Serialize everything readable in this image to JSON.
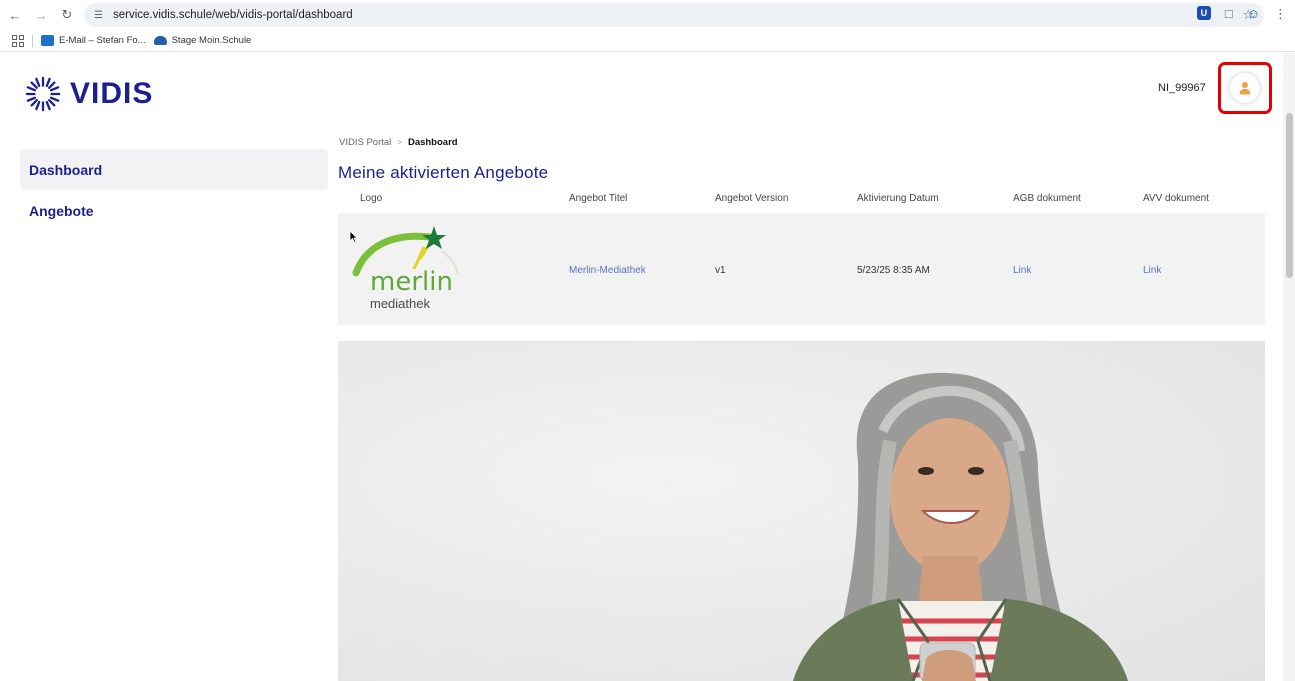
{
  "browser": {
    "url": "service.vidis.schule/web/vidis-portal/dashboard",
    "bookmarks": [
      {
        "label": "E-Mail – Stefan Fo..."
      },
      {
        "label": "Stage Moin.Schule"
      }
    ]
  },
  "header": {
    "brand": "VIDIS",
    "user_id": "NI_99967"
  },
  "sidebar": {
    "items": [
      {
        "label": "Dashboard",
        "active": true
      },
      {
        "label": "Angebote",
        "active": false
      }
    ]
  },
  "breadcrumb": {
    "root": "VIDIS Portal",
    "separator": ">",
    "current": "Dashboard"
  },
  "main": {
    "title": "Meine aktivierten Angebote",
    "table": {
      "columns": [
        "Logo",
        "Angebot Titel",
        "Angebot Version",
        "Aktivierung Datum",
        "AGB dokument",
        "AVV dokument"
      ],
      "rows": [
        {
          "logo_text": "merlin",
          "logo_subtext": "mediathek",
          "title": "Merlin-Mediathek",
          "version": "v1",
          "date": "5/23/25 8:35 AM",
          "agb": "Link",
          "avv": "Link"
        }
      ]
    }
  },
  "colors": {
    "brand": "#1b1f8f",
    "link": "#5474c4",
    "highlight_box": "#e20000",
    "avatar": "#f0a24a"
  }
}
